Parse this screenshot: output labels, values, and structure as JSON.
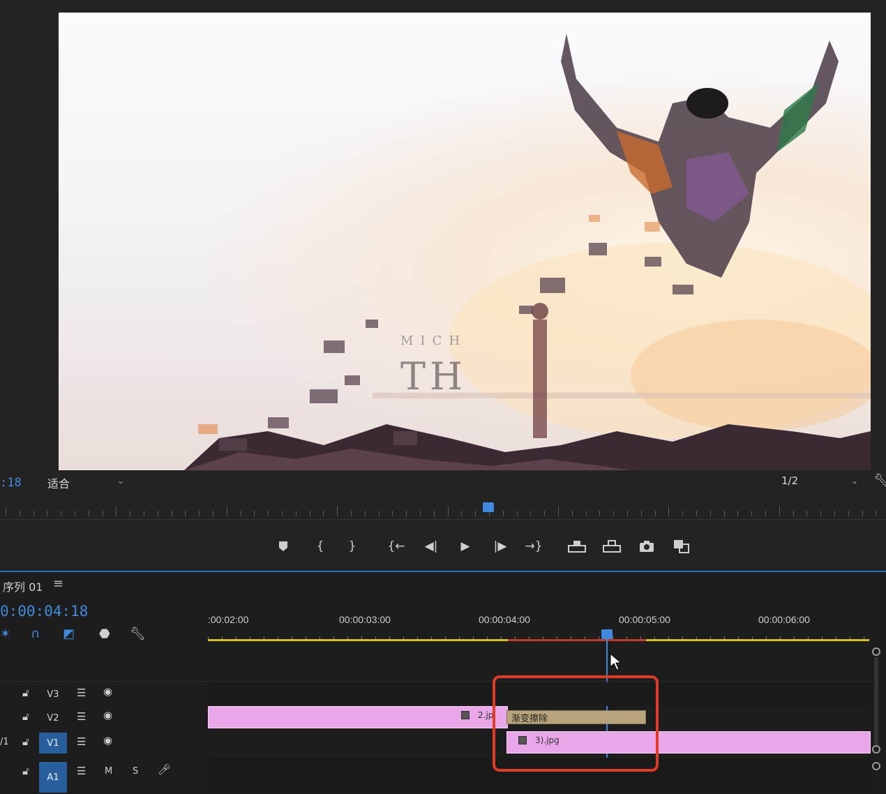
{
  "monitor": {
    "timecode": ":18",
    "fit_value": "适合",
    "resolution_value": "1/2",
    "video_overlay_text": "MICH",
    "video_title_text": "TH"
  },
  "transport": {
    "buttons": [
      "add-marker",
      "mark-in",
      "mark-out",
      "go-to-in",
      "step-back",
      "play",
      "step-forward",
      "go-to-out",
      "lift",
      "extract",
      "export-frame",
      "compare"
    ]
  },
  "sequence": {
    "title": "序列 01",
    "menu_glyph": "≡",
    "timecode": "0:00:04:18",
    "ruler_labels": [
      ":00:02:00",
      "00:00:03:00",
      "00:00:04:00",
      "00:00:05:00",
      "00:00:06:00"
    ]
  },
  "tracks": [
    {
      "id": "V3",
      "name": "V3",
      "active": false
    },
    {
      "id": "V2",
      "name": "V2",
      "active": false
    },
    {
      "id": "V1",
      "name": "V1",
      "active": true,
      "src_label": "/1"
    },
    {
      "id": "A1",
      "name": "A1",
      "active": true,
      "m": "M",
      "s": "S"
    }
  ],
  "clips": {
    "v2_clip_label": "2.jp",
    "transition_label": "渐变擦除",
    "v1_clip_label": "3).jpg"
  },
  "colors": {
    "accent": "#3f8ae0",
    "clip_pink": "#e9a6e8",
    "transition": "#b9a37a",
    "highlight_box": "#e03c25",
    "work_area": "#d6c11f"
  }
}
